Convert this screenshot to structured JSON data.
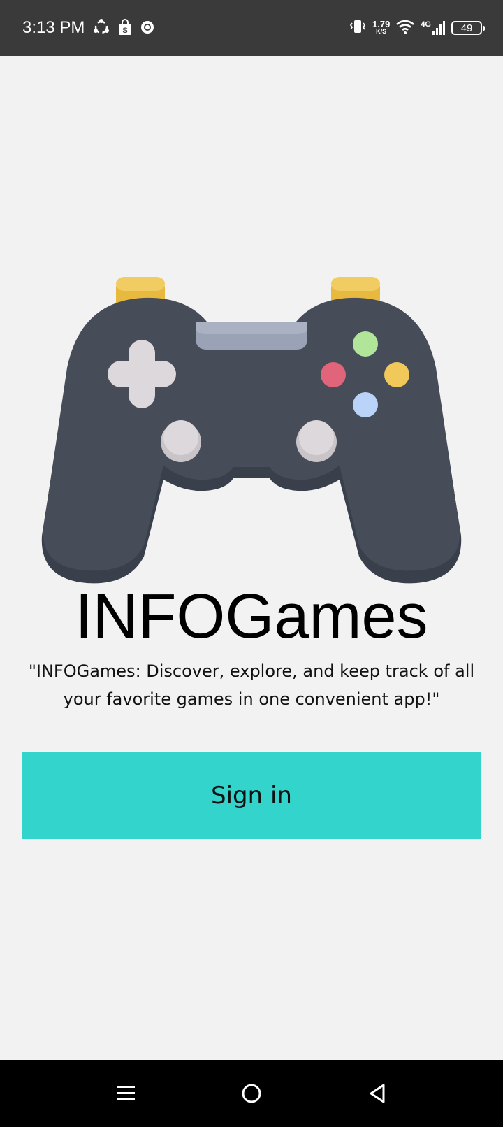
{
  "status_bar": {
    "time": "3:13 PM",
    "left_icons": [
      "sync-icon",
      "shopping-bag-icon",
      "chrome-icon"
    ],
    "net_speed_value": "1.79",
    "net_speed_unit": "K/S",
    "network_type": "4G",
    "battery_level": "49",
    "right_icons": [
      "vibrate-icon",
      "wifi-icon",
      "signal-icon",
      "battery-icon"
    ]
  },
  "hero": {
    "image": "game-controller-icon"
  },
  "app": {
    "title": "INFOGames",
    "tagline": "\"INFOGames: Discover, explore, and keep track of all your favorite games in one convenient app!\""
  },
  "actions": {
    "sign_in_label": "Sign in",
    "sign_in_color": "#33d4cc"
  },
  "nav_bar": {
    "items": [
      "menu-icon",
      "home-icon",
      "back-icon"
    ]
  },
  "colors": {
    "background": "#f2f2f2",
    "status_bar": "#3a3a3a",
    "controller_body": "#464d59",
    "controller_triggers": "#e8b93f",
    "button_green": "#b1e59a",
    "button_red": "#e0647a",
    "button_yellow": "#f0c95a",
    "button_blue": "#b9d4f8"
  }
}
